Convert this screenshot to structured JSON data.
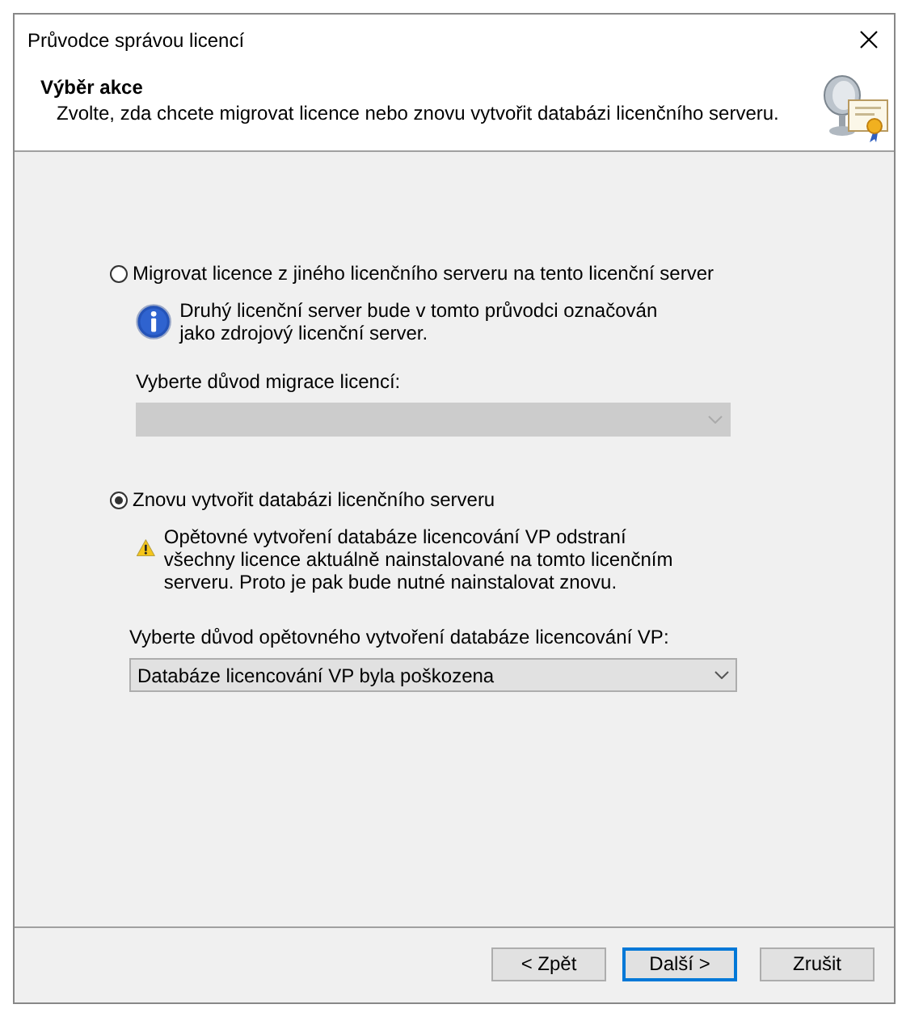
{
  "window": {
    "title": "Průvodce správou licencí"
  },
  "header": {
    "title": "Výběr akce",
    "subtitle": "Zvolte, zda chcete migrovat licence nebo znovu vytvořit databázi licenčního serveru."
  },
  "options": [
    {
      "label": "Migrovat licence z jiného licenčního serveru na tento licenční server",
      "selected": false,
      "note": {
        "kind": "info",
        "text": "Druhý licenční server bude v tomto průvodci označován jako zdrojový licenční server."
      },
      "combo": {
        "label": "Vyberte důvod migrace licencí:",
        "disabled": true
      }
    },
    {
      "label": "Znovu vytvořit databázi licenčního serveru",
      "selected": true,
      "note": {
        "kind": "warning",
        "text": "Opětovné vytvoření databáze licencování VP odstraní všechny licence aktuálně nainstalované na tomto licenčním serveru. Proto je pak bude nutné nainstalovat znovu."
      },
      "combo": {
        "label": "Vyberte důvod opětovného vytvoření databáze licencování VP:",
        "value": "Databáze licencování VP byla poškozena",
        "disabled": false
      }
    }
  ],
  "buttons": [
    {
      "label": "< Zpět",
      "default": false
    },
    {
      "label": "Další >",
      "default": true
    },
    {
      "label": "Zrušit",
      "default": false
    }
  ]
}
